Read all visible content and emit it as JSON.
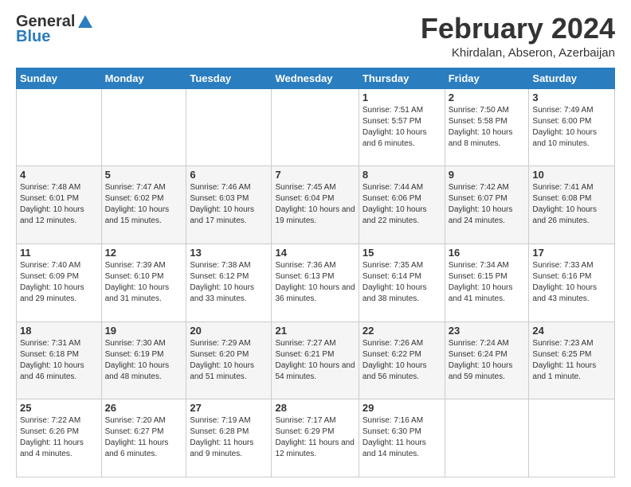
{
  "header": {
    "logo_general": "General",
    "logo_blue": "Blue",
    "title": "February 2024",
    "location": "Khirdalan, Abseron, Azerbaijan"
  },
  "columns": [
    "Sunday",
    "Monday",
    "Tuesday",
    "Wednesday",
    "Thursday",
    "Friday",
    "Saturday"
  ],
  "weeks": [
    [
      {
        "day": "",
        "info": ""
      },
      {
        "day": "",
        "info": ""
      },
      {
        "day": "",
        "info": ""
      },
      {
        "day": "",
        "info": ""
      },
      {
        "day": "1",
        "info": "Sunrise: 7:51 AM\nSunset: 5:57 PM\nDaylight: 10 hours\nand 6 minutes."
      },
      {
        "day": "2",
        "info": "Sunrise: 7:50 AM\nSunset: 5:58 PM\nDaylight: 10 hours\nand 8 minutes."
      },
      {
        "day": "3",
        "info": "Sunrise: 7:49 AM\nSunset: 6:00 PM\nDaylight: 10 hours\nand 10 minutes."
      }
    ],
    [
      {
        "day": "4",
        "info": "Sunrise: 7:48 AM\nSunset: 6:01 PM\nDaylight: 10 hours\nand 12 minutes."
      },
      {
        "day": "5",
        "info": "Sunrise: 7:47 AM\nSunset: 6:02 PM\nDaylight: 10 hours\nand 15 minutes."
      },
      {
        "day": "6",
        "info": "Sunrise: 7:46 AM\nSunset: 6:03 PM\nDaylight: 10 hours\nand 17 minutes."
      },
      {
        "day": "7",
        "info": "Sunrise: 7:45 AM\nSunset: 6:04 PM\nDaylight: 10 hours\nand 19 minutes."
      },
      {
        "day": "8",
        "info": "Sunrise: 7:44 AM\nSunset: 6:06 PM\nDaylight: 10 hours\nand 22 minutes."
      },
      {
        "day": "9",
        "info": "Sunrise: 7:42 AM\nSunset: 6:07 PM\nDaylight: 10 hours\nand 24 minutes."
      },
      {
        "day": "10",
        "info": "Sunrise: 7:41 AM\nSunset: 6:08 PM\nDaylight: 10 hours\nand 26 minutes."
      }
    ],
    [
      {
        "day": "11",
        "info": "Sunrise: 7:40 AM\nSunset: 6:09 PM\nDaylight: 10 hours\nand 29 minutes."
      },
      {
        "day": "12",
        "info": "Sunrise: 7:39 AM\nSunset: 6:10 PM\nDaylight: 10 hours\nand 31 minutes."
      },
      {
        "day": "13",
        "info": "Sunrise: 7:38 AM\nSunset: 6:12 PM\nDaylight: 10 hours\nand 33 minutes."
      },
      {
        "day": "14",
        "info": "Sunrise: 7:36 AM\nSunset: 6:13 PM\nDaylight: 10 hours\nand 36 minutes."
      },
      {
        "day": "15",
        "info": "Sunrise: 7:35 AM\nSunset: 6:14 PM\nDaylight: 10 hours\nand 38 minutes."
      },
      {
        "day": "16",
        "info": "Sunrise: 7:34 AM\nSunset: 6:15 PM\nDaylight: 10 hours\nand 41 minutes."
      },
      {
        "day": "17",
        "info": "Sunrise: 7:33 AM\nSunset: 6:16 PM\nDaylight: 10 hours\nand 43 minutes."
      }
    ],
    [
      {
        "day": "18",
        "info": "Sunrise: 7:31 AM\nSunset: 6:18 PM\nDaylight: 10 hours\nand 46 minutes."
      },
      {
        "day": "19",
        "info": "Sunrise: 7:30 AM\nSunset: 6:19 PM\nDaylight: 10 hours\nand 48 minutes."
      },
      {
        "day": "20",
        "info": "Sunrise: 7:29 AM\nSunset: 6:20 PM\nDaylight: 10 hours\nand 51 minutes."
      },
      {
        "day": "21",
        "info": "Sunrise: 7:27 AM\nSunset: 6:21 PM\nDaylight: 10 hours\nand 54 minutes."
      },
      {
        "day": "22",
        "info": "Sunrise: 7:26 AM\nSunset: 6:22 PM\nDaylight: 10 hours\nand 56 minutes."
      },
      {
        "day": "23",
        "info": "Sunrise: 7:24 AM\nSunset: 6:24 PM\nDaylight: 10 hours\nand 59 minutes."
      },
      {
        "day": "24",
        "info": "Sunrise: 7:23 AM\nSunset: 6:25 PM\nDaylight: 11 hours\nand 1 minute."
      }
    ],
    [
      {
        "day": "25",
        "info": "Sunrise: 7:22 AM\nSunset: 6:26 PM\nDaylight: 11 hours\nand 4 minutes."
      },
      {
        "day": "26",
        "info": "Sunrise: 7:20 AM\nSunset: 6:27 PM\nDaylight: 11 hours\nand 6 minutes."
      },
      {
        "day": "27",
        "info": "Sunrise: 7:19 AM\nSunset: 6:28 PM\nDaylight: 11 hours\nand 9 minutes."
      },
      {
        "day": "28",
        "info": "Sunrise: 7:17 AM\nSunset: 6:29 PM\nDaylight: 11 hours\nand 12 minutes."
      },
      {
        "day": "29",
        "info": "Sunrise: 7:16 AM\nSunset: 6:30 PM\nDaylight: 11 hours\nand 14 minutes."
      },
      {
        "day": "",
        "info": ""
      },
      {
        "day": "",
        "info": ""
      }
    ]
  ]
}
